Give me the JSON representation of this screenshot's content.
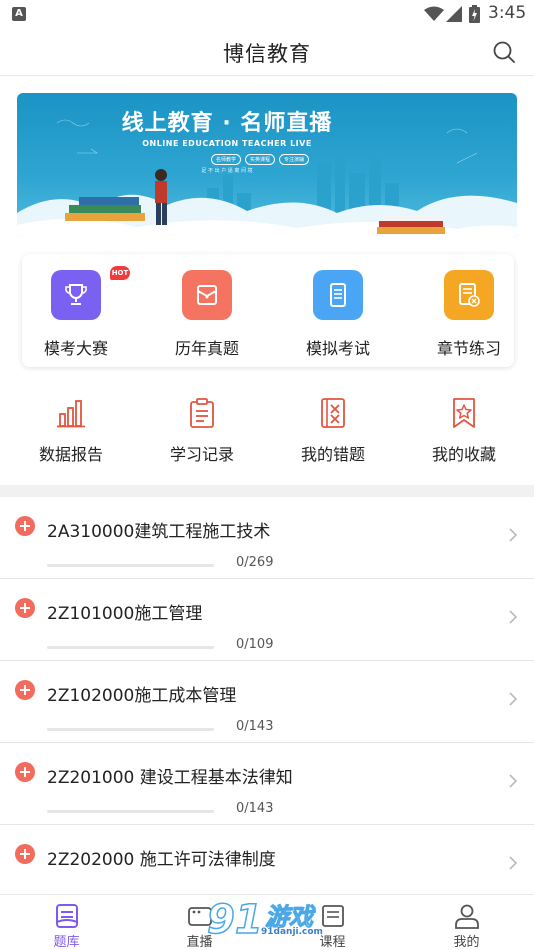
{
  "status_bar": {
    "notification_icon": "A",
    "time": "3:45"
  },
  "header": {
    "title": "博信教育"
  },
  "banner": {
    "title": "线上教育 · 名师直播",
    "subtitle": "ONLINE EDUCATION TEACHER LIVE",
    "tags": [
      "名师教学",
      "实英课程",
      "专注演辅"
    ],
    "note": "足 不 出 户 逼 离 间 境"
  },
  "features": [
    {
      "label": "模考大赛",
      "badge": "HOT",
      "icon": "trophy-icon",
      "color": "#7b61f2"
    },
    {
      "label": "历年真题",
      "icon": "envelope-icon",
      "color": "#f47361"
    },
    {
      "label": "模拟考试",
      "icon": "tablet-icon",
      "color": "#4aa6f5"
    },
    {
      "label": "章节练习",
      "icon": "document-cancel-icon",
      "color": "#f5a623"
    }
  ],
  "tools": [
    {
      "label": "数据报告",
      "icon": "bar-chart-icon"
    },
    {
      "label": "学习记录",
      "icon": "clipboard-icon"
    },
    {
      "label": "我的错题",
      "icon": "wrong-book-icon"
    },
    {
      "label": "我的收藏",
      "icon": "star-bookmark-icon"
    }
  ],
  "chapters": [
    {
      "name": "2A310000建筑工程施工技术",
      "done": 0,
      "total": 269,
      "count": "0/269"
    },
    {
      "name": "2Z101000施工管理",
      "done": 0,
      "total": 109,
      "count": "0/109"
    },
    {
      "name": "2Z102000施工成本管理",
      "done": 0,
      "total": 143,
      "count": "0/143"
    },
    {
      "name": "2Z201000 建设工程基本法律知",
      "done": 0,
      "total": 143,
      "count": "0/143"
    },
    {
      "name": "2Z202000 施工许可法律制度"
    }
  ],
  "tabbar": [
    {
      "label": "题库",
      "icon": "question-bank-icon",
      "active": true
    },
    {
      "label": "直播",
      "icon": "live-icon",
      "active": false
    },
    {
      "label": "课程",
      "icon": "course-icon",
      "active": false
    },
    {
      "label": "我的",
      "icon": "user-icon",
      "active": false
    }
  ],
  "watermark": {
    "text": "游戏",
    "site": "91danji.com"
  },
  "colors": {
    "accent": "#7f5af0",
    "primary_red": "#f26b5c",
    "tool_icon": "#e2563f"
  }
}
